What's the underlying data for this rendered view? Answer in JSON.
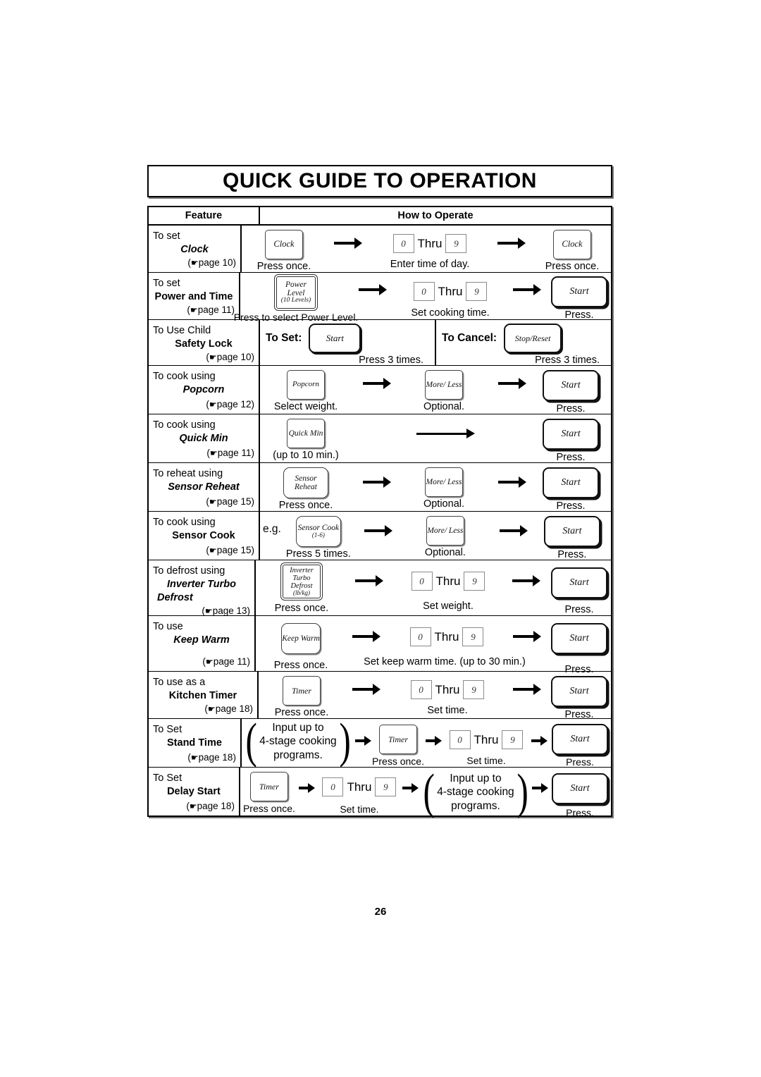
{
  "document": {
    "title": "QUICK GUIDE TO OPERATION",
    "page_number": "26"
  },
  "table": {
    "headers": {
      "feature": "Feature",
      "how_to_operate": "How to Operate"
    },
    "rows": [
      {
        "id": "clock",
        "feature_line1": "To set",
        "feature_line2": "Clock",
        "feature_style": "bold-italic",
        "page_ref": "page 10",
        "steps": [
          {
            "key": "Clock",
            "caption": "Press once."
          },
          {
            "digits": [
              "0",
              "9"
            ],
            "thru": "Thru",
            "caption": "Enter time of day."
          },
          {
            "key": "Clock",
            "caption": "Press once."
          }
        ]
      },
      {
        "id": "power-and-time",
        "feature_line1": "To set",
        "feature_line2": "Power and Time",
        "feature_style": "bold",
        "page_ref": "page 11",
        "steps": [
          {
            "key": "Power Level",
            "key_sub": "(10 Levels)",
            "caption": "Press to select Power Level."
          },
          {
            "digits": [
              "0",
              "9"
            ],
            "thru": "Thru",
            "caption": "Set cooking time."
          },
          {
            "key": "Start",
            "caption": "Press."
          }
        ]
      },
      {
        "id": "child-safety-lock",
        "feature_line1": "To Use Child",
        "feature_line2": "Safety Lock",
        "feature_style": "bold",
        "page_ref": "page 10",
        "set_label": "To Set:",
        "set_key": "Start",
        "set_caption": "Press 3 times.",
        "cancel_label": "To Cancel:",
        "cancel_key": "Stop/Reset",
        "cancel_caption": "Press 3 times."
      },
      {
        "id": "popcorn",
        "feature_line1": "To cook using",
        "feature_line2": "Popcorn",
        "feature_style": "bold-italic",
        "page_ref": "page 12",
        "steps": [
          {
            "key": "Popcorn",
            "caption": "Select weight."
          },
          {
            "key": "More/ Less",
            "caption": "Optional."
          },
          {
            "key": "Start",
            "caption": "Press."
          }
        ]
      },
      {
        "id": "quick-min",
        "feature_line1": "To cook using",
        "feature_line2": "Quick Min",
        "feature_style": "bold-italic",
        "page_ref": "page 11",
        "steps": [
          {
            "key": "Quick Min",
            "caption": "(up to 10 min.)"
          },
          {
            "key": "Start",
            "caption": "Press."
          }
        ]
      },
      {
        "id": "sensor-reheat",
        "feature_line1": "To reheat using",
        "feature_line2": "Sensor Reheat",
        "feature_style": "bold-italic",
        "page_ref": "page 15",
        "steps": [
          {
            "key": "Sensor Reheat",
            "caption": "Press once."
          },
          {
            "key": "More/ Less",
            "caption": "Optional."
          },
          {
            "key": "Start",
            "caption": "Press."
          }
        ]
      },
      {
        "id": "sensor-cook",
        "feature_line1": "To cook using",
        "feature_line2": "Sensor Cook",
        "feature_style": "bold",
        "page_ref": "page 15",
        "prefix": "e.g.",
        "steps": [
          {
            "key": "Sensor Cook",
            "key_sub": "(1-6)",
            "caption": "Press 5 times."
          },
          {
            "key": "More/ Less",
            "caption": "Optional."
          },
          {
            "key": "Start",
            "caption": "Press."
          }
        ]
      },
      {
        "id": "inverter-turbo-defrost",
        "feature_line1": "To defrost using",
        "feature_line2": "Inverter Turbo",
        "feature_line3": "Defrost",
        "feature_style": "bold-italic",
        "page_ref": "page 13",
        "steps": [
          {
            "key": "Inverter Turbo Defrost",
            "key_sub": "(lb/kg)",
            "caption": "Press once."
          },
          {
            "digits": [
              "0",
              "9"
            ],
            "thru": "Thru",
            "caption": "Set weight."
          },
          {
            "key": "Start",
            "caption": "Press."
          }
        ]
      },
      {
        "id": "keep-warm",
        "feature_line1": "To use",
        "feature_line2": "Keep Warm",
        "feature_style": "bold-italic",
        "page_ref": "page 11",
        "steps": [
          {
            "key": "Keep Warm",
            "caption": "Press once."
          },
          {
            "digits": [
              "0",
              "9"
            ],
            "thru": "Thru",
            "caption": "Set keep warm time. (up to 30 min.)"
          },
          {
            "key": "Start",
            "caption": "Press."
          }
        ]
      },
      {
        "id": "kitchen-timer",
        "feature_line1": "To use as a",
        "feature_line2": "Kitchen Timer",
        "feature_style": "bold",
        "page_ref": "page 18",
        "steps": [
          {
            "key": "Timer",
            "caption": "Press once."
          },
          {
            "digits": [
              "0",
              "9"
            ],
            "thru": "Thru",
            "caption": "Set time."
          },
          {
            "key": "Start",
            "caption": "Press."
          }
        ]
      },
      {
        "id": "stand-time",
        "feature_line1": "To Set",
        "feature_line2": "Stand Time",
        "feature_style": "bold",
        "page_ref": "page 18",
        "group_text": "Input up to\n4-stage cooking\nprograms.",
        "steps": [
          {
            "key": "Timer",
            "caption": "Press once."
          },
          {
            "digits": [
              "0",
              "9"
            ],
            "thru": "Thru",
            "caption": "Set time."
          },
          {
            "key": "Start",
            "caption": "Press."
          }
        ]
      },
      {
        "id": "delay-start",
        "feature_line1": "To Set",
        "feature_line2": "Delay Start",
        "feature_style": "bold",
        "page_ref": "page 18",
        "group_text": "Input up to\n4-stage cooking\nprograms.",
        "steps": [
          {
            "key": "Timer",
            "caption": "Press once."
          },
          {
            "digits": [
              "0",
              "9"
            ],
            "thru": "Thru",
            "caption": "Set time."
          },
          {
            "key": "Start",
            "caption": "Press."
          }
        ]
      }
    ]
  },
  "labels": {
    "thru": "Thru",
    "group_l1": "Input up to",
    "group_l2": "4-stage cooking",
    "group_l3": "programs.",
    "paren_open": "(",
    "paren_close": ")",
    "hand_icon": "☛"
  }
}
